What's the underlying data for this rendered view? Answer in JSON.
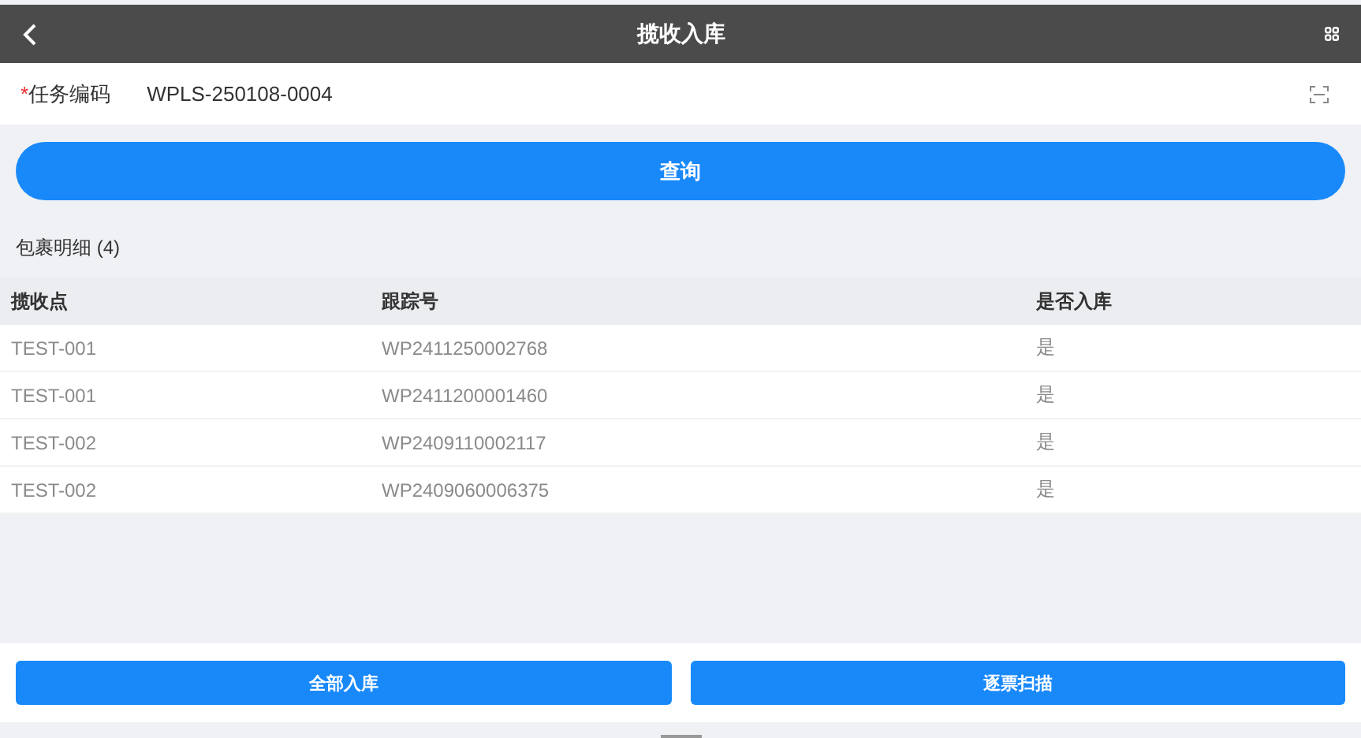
{
  "header": {
    "title": "揽收入库"
  },
  "task_field": {
    "label": "任务编码",
    "required_mark": "*",
    "value": "WPLS-250108-0004"
  },
  "query_button": "查询",
  "section": {
    "title": "包裹明细 (4)"
  },
  "table": {
    "columns": [
      "揽收点",
      "跟踪号",
      "是否入库"
    ],
    "rows": [
      [
        "TEST-001",
        "WP2411250002768",
        "是"
      ],
      [
        "TEST-001",
        "WP2411200001460",
        "是"
      ],
      [
        "TEST-002",
        "WP2409110002117",
        "是"
      ],
      [
        "TEST-002",
        "WP2409060006375",
        "是"
      ]
    ]
  },
  "footer_buttons": [
    "全部入库",
    "逐票扫描"
  ]
}
